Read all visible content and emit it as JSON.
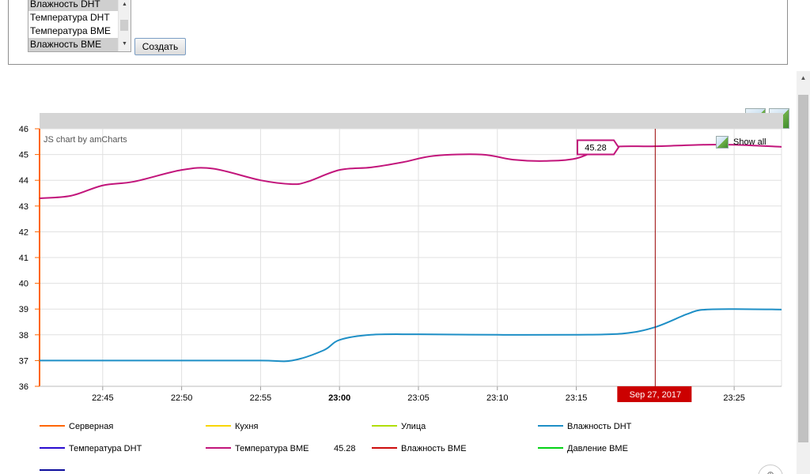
{
  "form": {
    "options": [
      {
        "label": "Влажность DHT",
        "selected": true
      },
      {
        "label": "Температура DHT",
        "selected": false
      },
      {
        "label": "Температура BME",
        "selected": false
      },
      {
        "label": "Влажность BME",
        "selected": true
      }
    ],
    "create_button": "Создать"
  },
  "chart_data": {
    "type": "line",
    "credit": "JS chart by amCharts",
    "show_all": "Show all",
    "ylim": [
      36,
      46
    ],
    "y_ticks": [
      36,
      37,
      38,
      39,
      40,
      41,
      42,
      43,
      44,
      45,
      46
    ],
    "x_axis": {
      "range": [
        "22:41",
        "23:28"
      ],
      "ticks": [
        {
          "t": "22:45",
          "label": "22:45",
          "bold": false
        },
        {
          "t": "22:50",
          "label": "22:50",
          "bold": false
        },
        {
          "t": "22:55",
          "label": "22:55",
          "bold": false
        },
        {
          "t": "23:00",
          "label": "23:00",
          "bold": true
        },
        {
          "t": "23:05",
          "label": "23:05",
          "bold": false
        },
        {
          "t": "23:10",
          "label": "23:10",
          "bold": false
        },
        {
          "t": "23:15",
          "label": "23:15",
          "bold": false
        },
        {
          "t": "23:25",
          "label": "23:25",
          "bold": false
        }
      ]
    },
    "cursor": {
      "t": "23:20",
      "label": "Sep 27, 2017",
      "value": 45.28,
      "value_label": "45.28"
    },
    "series": [
      {
        "name": "Серверная",
        "color": "#ff6600",
        "values": []
      },
      {
        "name": "Кухня",
        "color": "#f8d600",
        "values": []
      },
      {
        "name": "Улица",
        "color": "#b0de09",
        "values": []
      },
      {
        "name": "Влажность DHT",
        "color": "#1e8fc6",
        "values": [
          [
            "22:41",
            37.0
          ],
          [
            "22:45",
            37.0
          ],
          [
            "22:50",
            37.0
          ],
          [
            "22:55",
            37.0
          ],
          [
            "22:57",
            37.0
          ],
          [
            "22:59",
            37.4
          ],
          [
            "23:00",
            37.8
          ],
          [
            "23:02",
            38.0
          ],
          [
            "23:05",
            38.02
          ],
          [
            "23:10",
            38.0
          ],
          [
            "23:15",
            38.0
          ],
          [
            "23:18",
            38.05
          ],
          [
            "23:20",
            38.3
          ],
          [
            "23:22",
            38.8
          ],
          [
            "23:23",
            38.97
          ],
          [
            "23:25",
            39.0
          ],
          [
            "23:28",
            38.98
          ]
        ]
      },
      {
        "name": "Температура DHT",
        "color": "#2a0cd0",
        "values": []
      },
      {
        "name": "Температура BME",
        "color": "#c2157b",
        "values": [
          [
            "22:41",
            43.3
          ],
          [
            "22:43",
            43.4
          ],
          [
            "22:45",
            43.8
          ],
          [
            "22:47",
            43.95
          ],
          [
            "22:50",
            44.4
          ],
          [
            "22:52",
            44.45
          ],
          [
            "22:55",
            44.0
          ],
          [
            "22:57",
            43.85
          ],
          [
            "22:58",
            43.95
          ],
          [
            "23:00",
            44.4
          ],
          [
            "23:02",
            44.5
          ],
          [
            "23:04",
            44.7
          ],
          [
            "23:06",
            44.95
          ],
          [
            "23:09",
            45.0
          ],
          [
            "23:11",
            44.8
          ],
          [
            "23:13",
            44.75
          ],
          [
            "23:15",
            44.85
          ],
          [
            "23:17",
            45.28
          ],
          [
            "23:20",
            45.32
          ],
          [
            "23:23",
            45.38
          ],
          [
            "23:25",
            45.38
          ],
          [
            "23:28",
            45.3
          ]
        ]
      },
      {
        "name": "Влажность BME",
        "color": "#cd0d0d",
        "values": []
      },
      {
        "name": "Давление BME",
        "color": "#04d215",
        "values": []
      },
      {
        "name": "",
        "color": "#0d0d9c",
        "values": []
      }
    ]
  }
}
